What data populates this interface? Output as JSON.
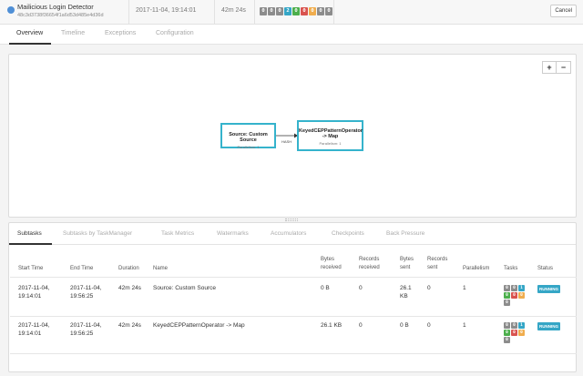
{
  "job": {
    "name": "Mailicious Login Detector",
    "id": "48c3d3738f36654f1a6d53d485e4d36d",
    "start_time": "2017-11-04, 19:14:01",
    "duration": "42m 24s",
    "cancel_label": "Cancel"
  },
  "status_counts": [
    {
      "value": "0",
      "color": "#8c8c8c"
    },
    {
      "value": "0",
      "color": "#8c8c8c"
    },
    {
      "value": "0",
      "color": "#8c8c8c"
    },
    {
      "value": "2",
      "color": "#35a6c6"
    },
    {
      "value": "0",
      "color": "#4cae4c"
    },
    {
      "value": "0",
      "color": "#d9534f"
    },
    {
      "value": "0",
      "color": "#f0ad4e"
    },
    {
      "value": "0",
      "color": "#8c8c8c"
    },
    {
      "value": "0",
      "color": "#8c8c8c"
    }
  ],
  "tabs": [
    {
      "label": "Overview",
      "active": true
    },
    {
      "label": "Timeline",
      "active": false
    },
    {
      "label": "Exceptions",
      "active": false
    },
    {
      "label": "Configuration",
      "active": false
    }
  ],
  "graph": {
    "zoom_in": "+",
    "zoom_out": "−",
    "nodes": [
      {
        "title": "Source: Custom Source",
        "parallelism": "Parallelism: 1"
      },
      {
        "title": "KeyedCEPPatternOperator -> Map",
        "parallelism": "Parallelism: 1"
      }
    ],
    "edge_label": "HASH"
  },
  "subtabs": [
    {
      "label": "Subtasks",
      "active": true
    },
    {
      "label": "Subtasks by TaskManager",
      "active": false
    },
    {
      "label": "Task Metrics",
      "active": false
    },
    {
      "label": "Watermarks",
      "active": false
    },
    {
      "label": "Accumulators",
      "active": false
    },
    {
      "label": "Checkpoints",
      "active": false
    },
    {
      "label": "Back Pressure",
      "active": false
    }
  ],
  "table": {
    "headers": {
      "start": "Start Time",
      "end": "End Time",
      "duration": "Duration",
      "name": "Name",
      "bytes_received": "Bytes received",
      "records_received": "Records received",
      "bytes_sent": "Bytes sent",
      "records_sent": "Records sent",
      "parallelism": "Parallelism",
      "tasks": "Tasks",
      "status": "Status"
    },
    "rows": [
      {
        "start": "2017-11-04, 19:14:01",
        "end": "2017-11-04, 19:56:25",
        "duration": "42m 24s",
        "name": "Source: Custom Source",
        "bytes_received": "0 B",
        "records_received": "0",
        "bytes_sent": "26.1 KB",
        "records_sent": "0",
        "parallelism": "1",
        "tasks": [
          {
            "value": "0",
            "color": "#8c8c8c"
          },
          {
            "value": "0",
            "color": "#8c8c8c"
          },
          {
            "value": "1",
            "color": "#35a6c6"
          },
          {
            "value": "0",
            "color": "#4cae4c"
          },
          {
            "value": "0",
            "color": "#d9534f"
          },
          {
            "value": "0",
            "color": "#f0ad4e"
          },
          {
            "value": "0",
            "color": "#8c8c8c"
          }
        ],
        "status": "RUNNING"
      },
      {
        "start": "2017-11-04, 19:14:01",
        "end": "2017-11-04, 19:56:25",
        "duration": "42m 24s",
        "name": "KeyedCEPPatternOperator -> Map",
        "bytes_received": "26.1 KB",
        "records_received": "0",
        "bytes_sent": "0 B",
        "records_sent": "0",
        "parallelism": "1",
        "tasks": [
          {
            "value": "0",
            "color": "#8c8c8c"
          },
          {
            "value": "0",
            "color": "#8c8c8c"
          },
          {
            "value": "1",
            "color": "#35a6c6"
          },
          {
            "value": "0",
            "color": "#4cae4c"
          },
          {
            "value": "0",
            "color": "#d9534f"
          },
          {
            "value": "0",
            "color": "#f0ad4e"
          },
          {
            "value": "0",
            "color": "#8c8c8c"
          }
        ],
        "status": "RUNNING"
      }
    ]
  }
}
